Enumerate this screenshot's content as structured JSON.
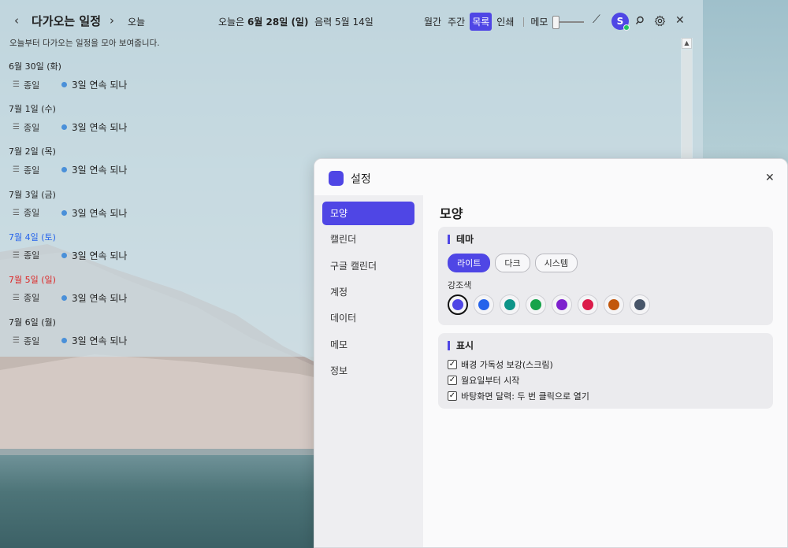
{
  "toolbar": {
    "title": "다가오는 일정",
    "today_label": "오늘",
    "date_prefix": "오늘은",
    "date_main": "6월 28일 (일)",
    "lunar": "음력 5월 14일",
    "views": [
      "월간",
      "주간",
      "목록",
      "인쇄"
    ],
    "active_view": "목록",
    "memo_label": "메모",
    "memo_slider_value": 0,
    "avatar_initial": "S"
  },
  "subtitle": "오늘부터 다가오는 일정을 모아 보여줍니다.",
  "days": [
    {
      "label": "6월 30일 (화)",
      "kind": "weekday",
      "allday": "종일",
      "event": "3일 연속 되나"
    },
    {
      "label": "7월 1일 (수)",
      "kind": "weekday",
      "allday": "종일",
      "event": "3일 연속 되나"
    },
    {
      "label": "7월 2일 (목)",
      "kind": "weekday",
      "allday": "종일",
      "event": "3일 연속 되나"
    },
    {
      "label": "7월 3일 (금)",
      "kind": "weekday",
      "allday": "종일",
      "event": "3일 연속 되나"
    },
    {
      "label": "7월 4일 (토)",
      "kind": "sat",
      "allday": "종일",
      "event": "3일 연속 되나"
    },
    {
      "label": "7월 5일 (일)",
      "kind": "sun",
      "allday": "종일",
      "event": "3일 연속 되나"
    },
    {
      "label": "7월 6일 (월)",
      "kind": "weekday",
      "allday": "종일",
      "event": "3일 연속 되나"
    }
  ],
  "settings": {
    "title": "설정",
    "nav": [
      "모양",
      "캘린더",
      "구글 캘린더",
      "계정",
      "데이터",
      "메모",
      "정보"
    ],
    "active_nav": "모양",
    "heading": "모양",
    "theme": {
      "title": "테마",
      "options": [
        "라이트",
        "다크",
        "시스템"
      ],
      "selected": "라이트",
      "accent_label": "강조색",
      "accent_colors": [
        "#4f46e5",
        "#2563eb",
        "#0d9488",
        "#16a34a",
        "#7e22ce",
        "#db1b4a",
        "#c2570c",
        "#475569"
      ],
      "selected_accent": "#4f46e5"
    },
    "display": {
      "title": "표시",
      "options": [
        {
          "label": "배경 가독성 보강(스크림)",
          "checked": true
        },
        {
          "label": "월요일부터 시작",
          "checked": true
        },
        {
          "label": "바탕화면 달력: 두 번 클릭으로 열기",
          "checked": true
        }
      ]
    }
  }
}
